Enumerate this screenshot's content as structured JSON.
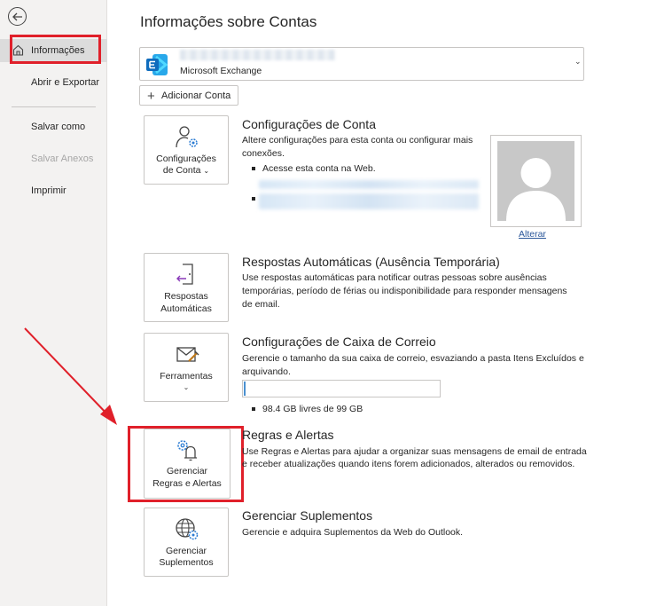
{
  "sidebar": {
    "items": [
      {
        "label": "Informações"
      },
      {
        "label": "Abrir e Exportar"
      },
      {
        "label": "Salvar como"
      },
      {
        "label": "Salvar Anexos"
      },
      {
        "label": "Imprimir"
      }
    ]
  },
  "main": {
    "title": "Informações sobre Contas",
    "account": {
      "type": "Microsoft Exchange"
    },
    "add_account_label": "Adicionar Conta",
    "sections": [
      {
        "tile_label_1": "Configurações",
        "tile_label_2": "de Conta",
        "title": "Configurações de Conta",
        "desc_1": "Altere configurações para esta conta ou configurar mais",
        "desc_2": "conexões.",
        "bullet_1": "Acesse esta conta na Web."
      },
      {
        "tile_label_1": "Respostas",
        "tile_label_2": "Automáticas",
        "title": "Respostas Automáticas (Ausência Temporária)",
        "desc_1": "Use respostas automáticas para notificar outras pessoas sobre ausências",
        "desc_2": "temporárias, período de férias ou indisponibilidade para responder mensagens",
        "desc_3": "de email."
      },
      {
        "tile_label_1": "Ferramentas",
        "title": "Configurações de Caixa de Correio",
        "desc_1": "Gerencie o tamanho da sua caixa de correio, esvaziando a pasta Itens Excluídos e",
        "desc_2": "arquivando.",
        "storage_text": "98.4 GB livres de 99 GB",
        "storage_used_fraction": 0.006
      },
      {
        "tile_label_1": "Gerenciar",
        "tile_label_2": "Regras e Alertas",
        "title": "Regras e Alertas",
        "desc_1": "Use Regras e Alertas para ajudar a organizar suas mensagens de email de entrada",
        "desc_2": "e receber atualizações quando itens forem adicionados, alterados ou removidos."
      },
      {
        "tile_label_1": "Gerenciar",
        "tile_label_2": "Suplementos",
        "title": "Gerenciar Suplementos",
        "desc_1": "Gerencie e adquira Suplementos da Web do Outlook."
      }
    ],
    "photo": {
      "change_label": "Alterar"
    }
  },
  "colors": {
    "highlight": "#e0202a",
    "accent": "#2b579a",
    "exchange": "#0f6cbd"
  },
  "icons": [
    "back-arrow-icon",
    "home-icon",
    "exchange-icon",
    "plus-icon",
    "user-gear-icon",
    "door-arrow-icon",
    "mailbox-tools-icon",
    "gear-bell-icon",
    "globe-gear-icon",
    "default-avatar-icon"
  ]
}
